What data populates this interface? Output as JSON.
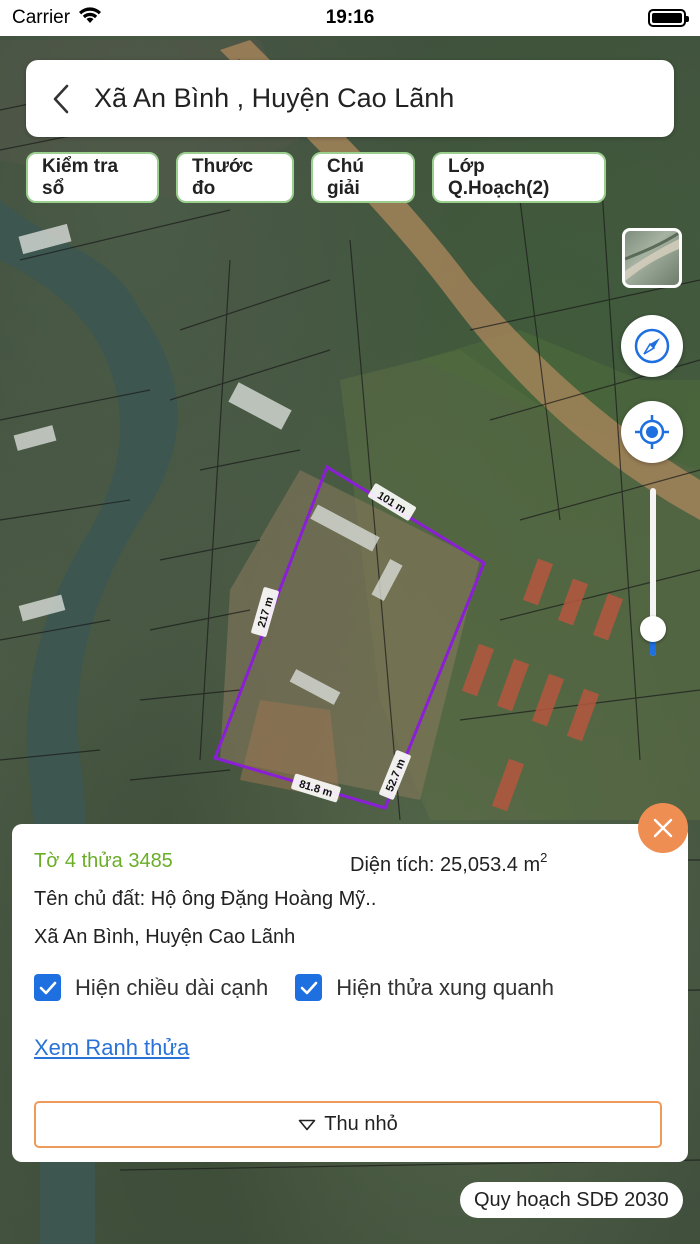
{
  "status_bar": {
    "carrier": "Carrier",
    "time": "19:16"
  },
  "header": {
    "title": "Xã An Bình , Huyện Cao Lãnh"
  },
  "chips": [
    {
      "label": "Kiểm tra sổ"
    },
    {
      "label": "Thước đo"
    },
    {
      "label": "Chú giải"
    },
    {
      "label": "Lớp Q.Hoạch(2)"
    }
  ],
  "map": {
    "edge_labels": {
      "top": "101 m",
      "left": "217 m",
      "bottom": "81.8 m",
      "right": "52.7 m"
    },
    "zoom_level_fraction": 0.16,
    "colors": {
      "parcel_outline": "#8a1fd6",
      "canal": "#3d5750",
      "road": "#a28259"
    }
  },
  "panel": {
    "parcel_label": "Tờ 4 thửa 3485",
    "area_label": "Diện tích: 25,053.4 m",
    "area_unit_exp": "2",
    "owner": "Tên chủ đất: Hộ ông Đặng Hoàng Mỹ..",
    "address": "Xã An Bình, Huyện Cao Lãnh",
    "check_edges_label": "Hiện chiều dài cạnh",
    "check_neighbors_label": "Hiện thửa xung quanh",
    "check_edges_checked": true,
    "check_neighbors_checked": true,
    "link_label": "Xem Ranh thửa",
    "collapse_label": "Thu nhỏ"
  },
  "plan_badge": "Quy hoạch SDĐ 2030",
  "colors": {
    "accent_green": "#6aae28",
    "accent_blue": "#1e6fe0",
    "accent_orange": "#ee8e52"
  }
}
